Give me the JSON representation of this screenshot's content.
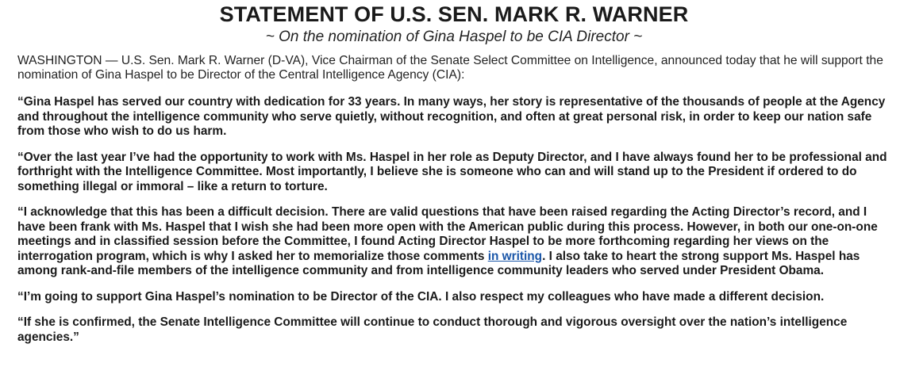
{
  "header": {
    "title": "STATEMENT OF U.S. SEN. MARK R. WARNER",
    "subtitle": "~ On the nomination of Gina Haspel to be CIA Director ~"
  },
  "body": {
    "intro": "WASHINGTON — U.S. Sen. Mark R. Warner (D-VA), Vice Chairman of the Senate Select Committee on Intelligence, announced today that he will support the nomination of Gina Haspel to be Director of the Central Intelligence Agency (CIA):",
    "quote1": "“Gina Haspel has served our country with dedication for 33 years. In many ways, her story is representative of the thousands of people at the Agency and throughout the intelligence community who serve quietly, without recognition, and often at great personal risk, in order to keep our nation safe from those who wish to do us harm.",
    "quote2": "“Over the last year I’ve had the opportunity to work with Ms. Haspel in her role as Deputy Director, and I have always found her to be professional and forthright with the Intelligence Committee. Most importantly, I believe she is someone who can and will stand up to the President if ordered to do something illegal or immoral – like a return to torture.",
    "quote3_before_link": "“I acknowledge that this has been a difficult decision. There are valid questions that have been raised regarding the Acting Director’s record, and I have been frank with Ms. Haspel that I wish she had been more open with the American public during this process. However, in both our one-on-one meetings and in classified session before the Committee, I found Acting Director Haspel to be more forthcoming regarding her views on the interrogation program, which is why I asked her to memorialize those comments ",
    "quote3_link": "in writing",
    "quote3_after_link": ". I also take to heart the strong support Ms. Haspel has among rank-and-file members of the intelligence community and from intelligence community leaders who served under President Obama.",
    "quote4": "“I’m going to support Gina Haspel’s nomination to be Director of the CIA. I also respect my colleagues who have made a different decision.",
    "quote5": "“If she is confirmed, the Senate Intelligence Committee will continue to conduct thorough and vigorous oversight over the nation’s intelligence agencies.”"
  },
  "colors": {
    "link": "#1a56a8",
    "text": "#1a1a1a",
    "background": "#ffffff"
  }
}
